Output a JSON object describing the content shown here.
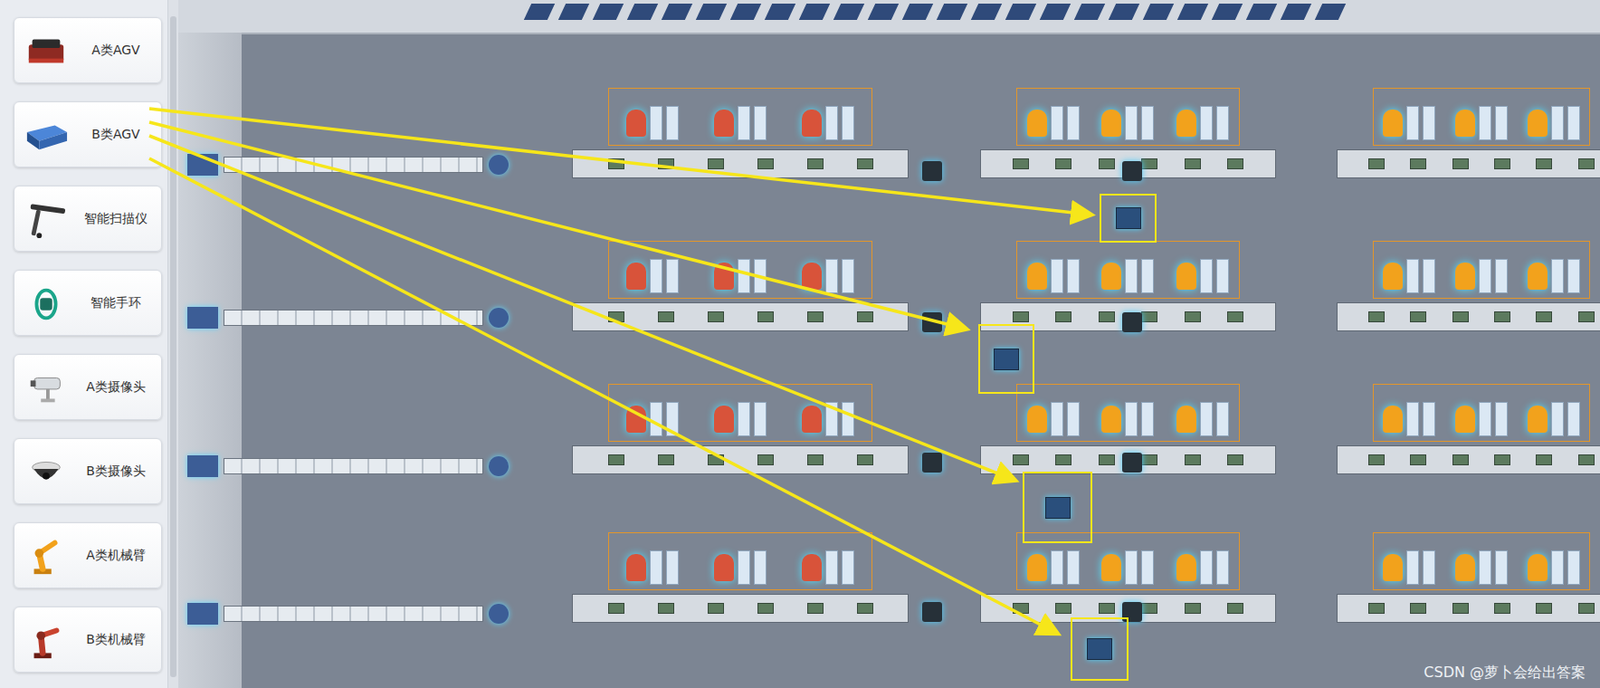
{
  "sidebar": {
    "items": [
      {
        "label": "A类AGV",
        "selected": false
      },
      {
        "label": "B类AGV",
        "selected": false
      },
      {
        "label": "智能扫描仪",
        "selected": false
      },
      {
        "label": "智能手环",
        "selected": false
      },
      {
        "label": "A类摄像头",
        "selected": false
      },
      {
        "label": "B类摄像头",
        "selected": false
      },
      {
        "label": "A类机械臂",
        "selected": false
      },
      {
        "label": "B类机械臂",
        "selected": false
      }
    ]
  },
  "floor_markers": [
    {
      "highlighted": true
    },
    {
      "highlighted": true
    },
    {
      "highlighted": true
    },
    {
      "highlighted": true
    }
  ],
  "watermark": "CSDN @萝卜会给出答案"
}
